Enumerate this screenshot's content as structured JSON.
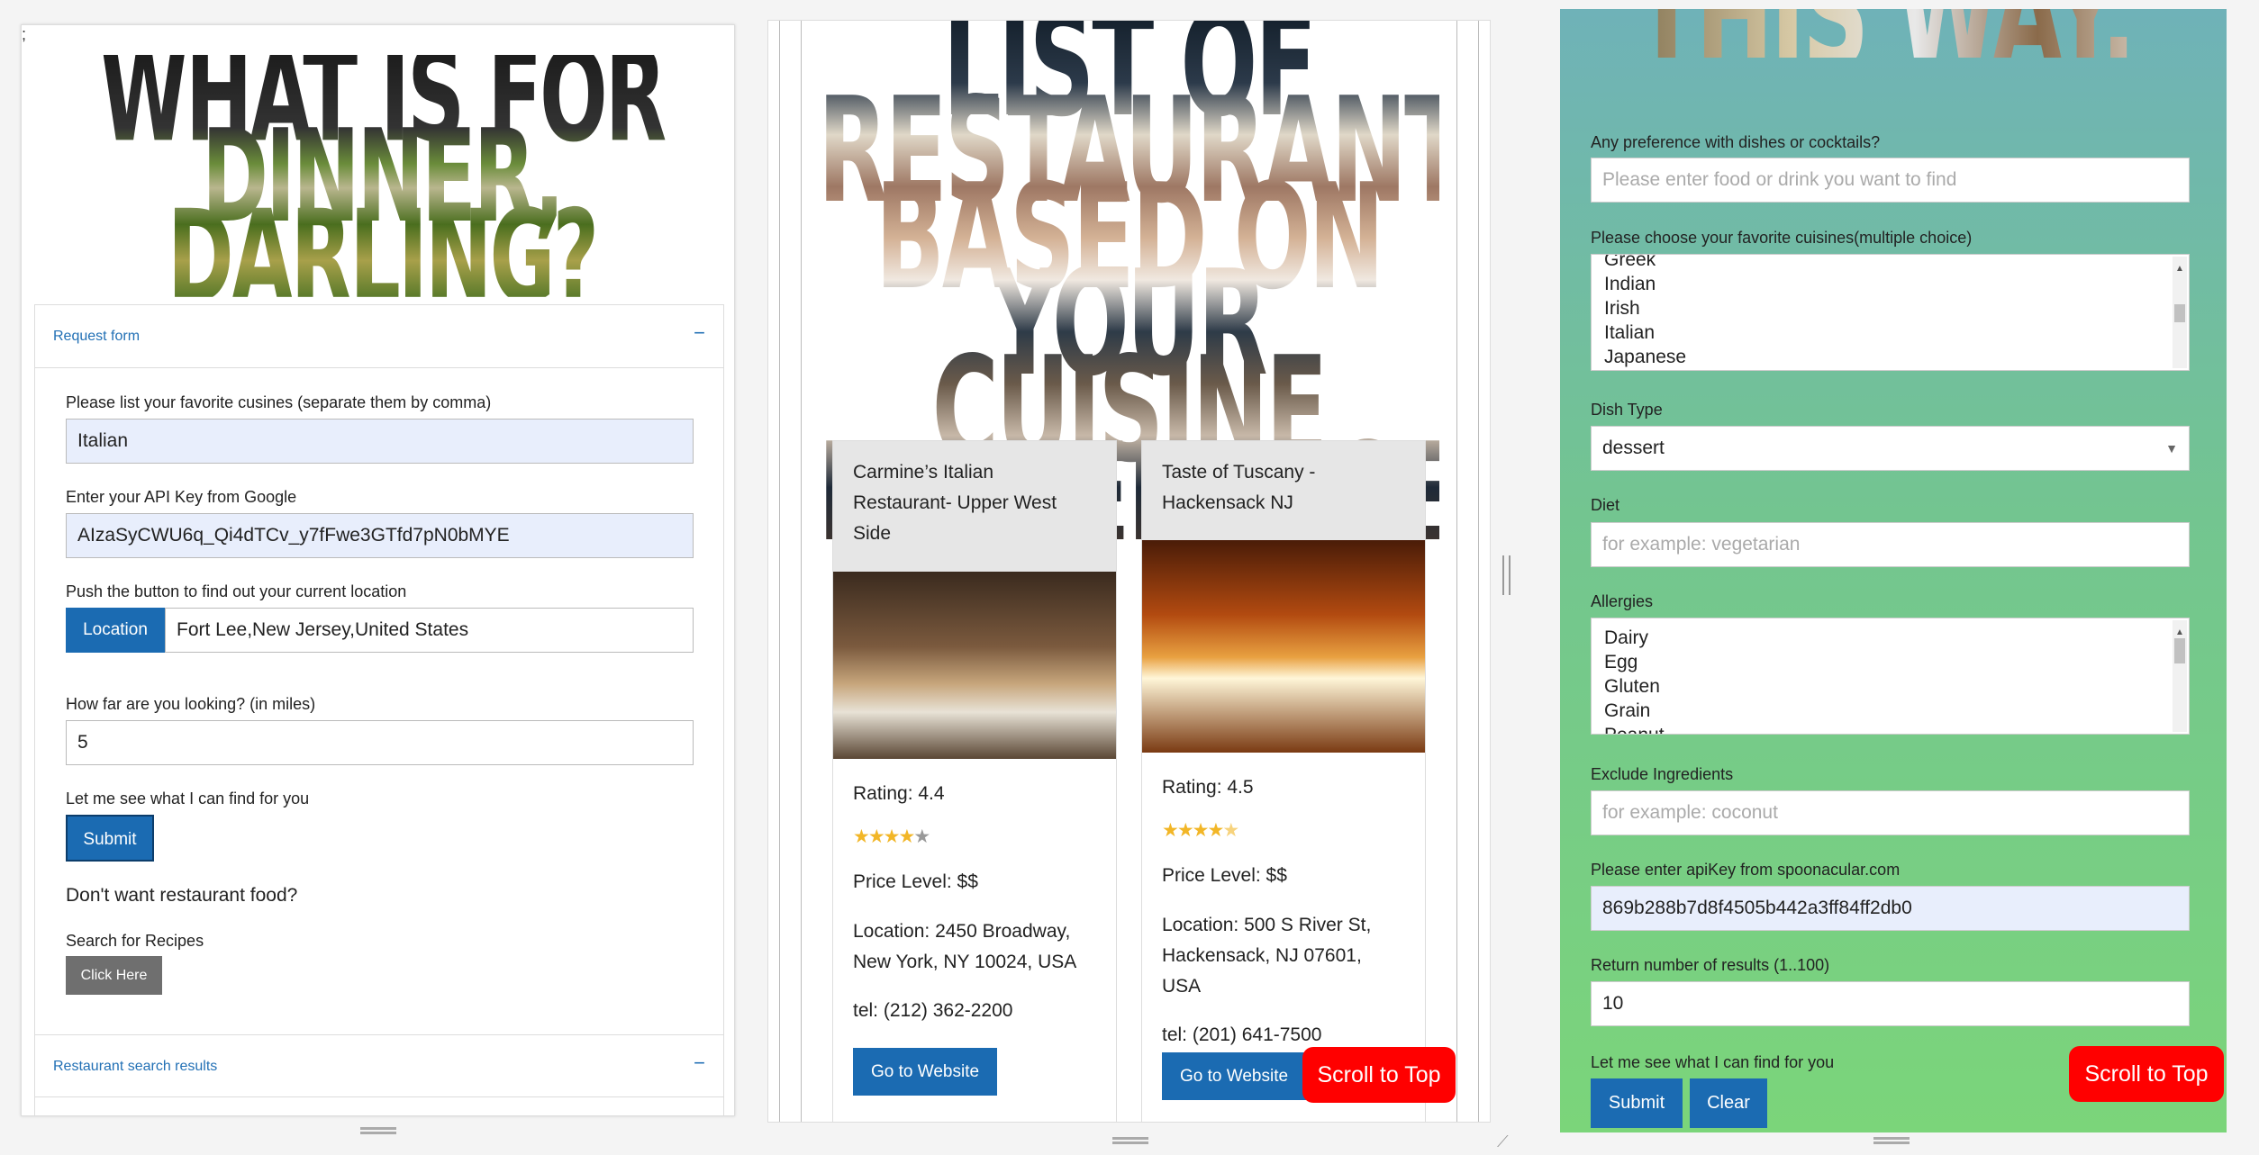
{
  "panel1": {
    "semicolon": ";",
    "hero_text": "WHAT IS FOR DINNER, DARLING?",
    "request_form_title": "Request form",
    "collapse": "−",
    "cuisines_label": "Please list your favorite cusines (separate them by comma)",
    "cuisines_value": "Italian",
    "api_label": "Enter your API Key from Google",
    "api_value": "AIzaSyCWU6q_Qi4dTCv_y7fFwe3GTfd7pN0bMYE",
    "location_label": "Push the button to find out your current location",
    "location_button": "Location",
    "location_value": "Fort Lee,New Jersey,United States",
    "distance_label": "How far are you looking? (in miles)",
    "distance_value": "5",
    "submit_label": "Let me see what I can find for you",
    "submit_button": "Submit",
    "alt_prompt": "Don't want restaurant food?",
    "recipes_label": "Search for Recipes",
    "click_here": "Click Here",
    "results_title": "Restaurant search results"
  },
  "panel2": {
    "hero_text": "LIST OF RESTAURANTS BASED ON YOUR CUISINE PREFERENCE",
    "restaurants": [
      {
        "name": "Carmine’s Italian Restaurant- Upper West Side",
        "rating_text": "Rating: 4.4",
        "rating": 4.4,
        "price": "Price Level: $$",
        "location": "Location: 2450 Broadway, New York, NY 10024, USA",
        "tel": "tel: (212) 362-2200",
        "button": "Go to Website"
      },
      {
        "name": "Taste of Tuscany - Hackensack NJ",
        "rating_text": "Rating: 4.5",
        "rating": 4.5,
        "price": "Price Level: $$",
        "location": "Location: 500 S River St, Hackensack, NJ 07601, USA",
        "tel": "tel: (201) 641-7500",
        "button": "Go to Website"
      }
    ],
    "scroll_top": "Scroll to Top"
  },
  "panel3": {
    "hero_text": "THIS WAY.",
    "pref_label": "Any preference with dishes or cocktails?",
    "pref_placeholder": "Please enter food or drink you want to find",
    "cuisines_label": "Please choose your favorite cuisines(multiple choice)",
    "cuisine_options": [
      "Greek",
      "Indian",
      "Irish",
      "Italian",
      "Japanese"
    ],
    "dish_label": "Dish Type",
    "dish_value": "dessert",
    "diet_label": "Diet",
    "diet_placeholder": "for example: vegetarian",
    "allergies_label": "Allergies",
    "allergy_options": [
      "Dairy",
      "Egg",
      "Gluten",
      "Grain",
      "Peanut"
    ],
    "exclude_label": "Exclude Ingredients",
    "exclude_placeholder": "for example: coconut",
    "apikey_label": "Please enter apiKey from spoonacular.com",
    "apikey_value": "869b288b7d8f4505b442a3ff84ff2db0",
    "results_label": "Return number of results (1..100)",
    "results_value": "10",
    "submit_label": "Let me see what I can find for you",
    "submit_button": "Submit",
    "clear_button": "Clear",
    "scroll_top": "Scroll to Top"
  }
}
